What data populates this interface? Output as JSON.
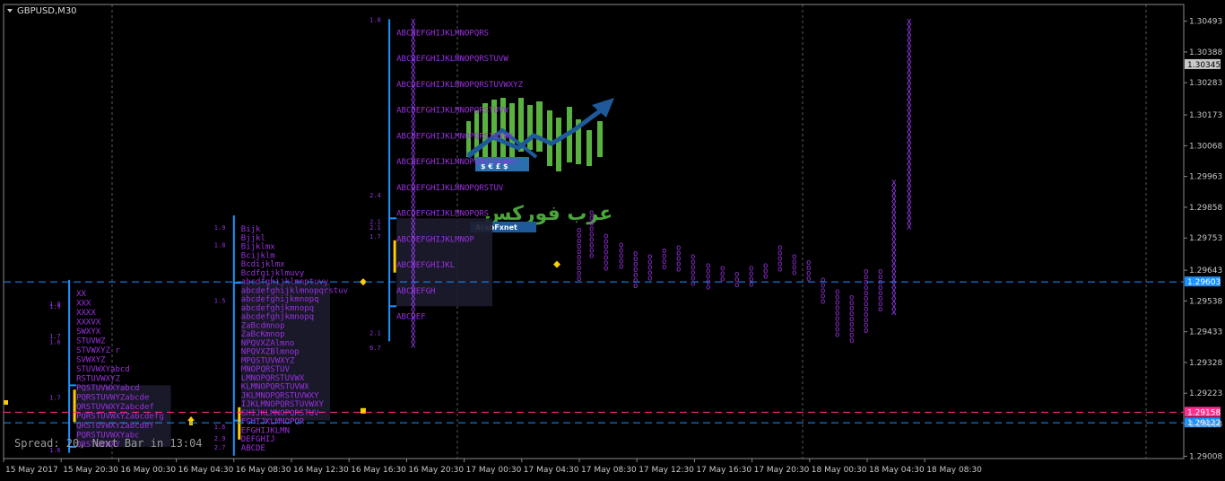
{
  "window": {
    "symbol": "GBPUSD,M30"
  },
  "status": {
    "text": "Spread: 20, Next Bar in 13:04"
  },
  "logo": {
    "arabic": "عرب فوركس",
    "latin": "ArabFxnet"
  },
  "colors": {
    "background": "#000000",
    "grid": "#5a5a5a",
    "axis": "#c8c8c8",
    "blue_line": "#1e90ff",
    "pink_line": "#ff2f8f",
    "tpo": "#9a30e0",
    "profile_bar": "#1e90ff",
    "poc": "#ffd000",
    "value_area": "#1c1c2e"
  },
  "chart_data": {
    "type": "line",
    "title": "",
    "xlabel": "",
    "ylabel": "",
    "ylim": [
      1.29,
      1.3055
    ],
    "y_ticks": [
      "1.30493",
      "1.30388",
      "1.30283",
      "1.30173",
      "1.30068",
      "1.29963",
      "1.29858",
      "1.29753",
      "1.29643",
      "1.29538",
      "1.29433",
      "1.29328",
      "1.29223",
      "1.29118",
      "1.29008"
    ],
    "x_ticks": [
      "15 May 2017",
      "15 May 20:30",
      "16 May 00:30",
      "16 May 04:30",
      "16 May 08:30",
      "16 May 12:30",
      "16 May 16:30",
      "16 May 20:30",
      "17 May 00:30",
      "17 May 04:30",
      "17 May 08:30",
      "17 May 12:30",
      "17 May 16:30",
      "17 May 20:30",
      "18 May 00:30",
      "18 May 04:30",
      "18 May 08:30"
    ],
    "price_lines": [
      {
        "name": "",
        "value": 1.30345,
        "label": "1.30345",
        "color": "#c8c8c8",
        "style": "solid"
      },
      {
        "name": "",
        "value": 1.29603,
        "label": "1.29603",
        "color": "#1e90ff",
        "style": "dashed"
      },
      {
        "name": "",
        "value": 1.29158,
        "label": "1.29158",
        "color": "#ff2f8f",
        "style": "dashed"
      },
      {
        "name": "",
        "value": 1.29122,
        "label": "1.29122",
        "color": "#1e90ff",
        "style": "dashed"
      }
    ],
    "sessions": [
      {
        "x_start": 0.5,
        "x_end": 4.0,
        "high": 1.2961,
        "low": 1.2902,
        "va_high": 1.2925,
        "va_low": 1.2904,
        "poc": 1.2918,
        "labels": [
          {
            "text": "1.9",
            "y": 1.2953
          },
          {
            "text": "1.9",
            "y": 1.2952
          },
          {
            "text": "1.7",
            "y": 1.2942
          },
          {
            "text": "1.6",
            "y": 1.294
          },
          {
            "text": "1.7",
            "y": 1.2921
          },
          {
            "text": "1.6",
            "y": 1.2903
          }
        ],
        "tpo": [
          "XX",
          "XXX",
          "XXXX",
          "XXXVX",
          "SWXYX",
          "STUVWZ",
          "STVWXYZ r",
          "SVWXYZ",
          "STUVWXYabcd",
          "RSTUVWXYZ",
          "PQSTUVWXYabcd",
          "PQRSTUVWYZabcde",
          "QRSTUVWXYZabcdef",
          "PQRSTUVWXYZabcdefg",
          "QRSTUVWXYZabcdef",
          "PQRSTUVWXYabc",
          "QRSTUVWXY"
        ]
      },
      {
        "x_start": 4.0,
        "x_end": 6.7,
        "high": 1.2983,
        "low": 1.2901,
        "va_high": 1.296,
        "va_low": 1.2913,
        "poc": 1.2912,
        "labels": [
          {
            "text": "1.9",
            "y": 1.2979
          },
          {
            "text": "1.8",
            "y": 1.2973
          },
          {
            "text": "1.5",
            "y": 1.2954
          },
          {
            "text": "1.6",
            "y": 1.2911
          },
          {
            "text": "2.9",
            "y": 1.2907
          },
          {
            "text": "2.7",
            "y": 1.2904
          }
        ],
        "tpo": [
          "Bijk",
          "Bjjkl",
          "Bijklmx",
          "Bcijklm",
          "Bcdijklmx",
          "Bcdfgijklmuvy",
          "abcdfghijklmnptuvy",
          "abcdefghijklmnopqrstuv",
          "abcdefghijkmnopq",
          "abcdefghjkmnopq",
          "abcdefghjkmnopq",
          "ZaBcdmnop",
          "ZaBcKmnop",
          "NPQVXZAlmno",
          "NPQVXZBlmnop",
          "MPQSTUVWXYZ",
          "MNOPQRSTUV",
          "LMNOPQRSTUVWX",
          "KLMNOPQRSTUVWX",
          "JKLMNOPQRSTUVWXY",
          "IJKLMNOPQRSTUVWXY",
          "GHIJKLMNOPQRSTUV",
          "FGHIJKLMNOPQR",
          "EFGHIJKLMN",
          "DEFGHIJ",
          "ABCDE"
        ]
      },
      {
        "x_start": 6.7,
        "x_end": 9.6,
        "high": 1.305,
        "low": 1.294,
        "va_high": 1.2982,
        "va_low": 1.2952,
        "poc": 1.2969,
        "labels": [
          {
            "text": "1.8",
            "y": 1.305
          },
          {
            "text": "2.4",
            "y": 1.299
          },
          {
            "text": "2.1",
            "y": 1.2981
          },
          {
            "text": "2.1",
            "y": 1.2979
          },
          {
            "text": "1.7",
            "y": 1.2976
          },
          {
            "text": "2.1",
            "y": 1.2943
          },
          {
            "text": "6.7",
            "y": 1.2938
          }
        ],
        "tpo": [
          "ABCDEFGHIJKLMNOPQRS",
          "ABCDEFGHIJKLMNOPQRSTUVW",
          "ABCDEFGHIJKLMNOPQRSTUVWXYZ",
          "ABCDEFGHIJKLMNOPQRSTUVW",
          "ABCDEFGHIJKLMNOPQRSTUVWX",
          "ABCDEFGHIJKLMNOPQRSTUVWXY",
          "ABCDEFGHIJKLMNOPQRSTUV",
          "ABCDEFGHIJKLMNOPQRS",
          "ABCDEFGHIJKLMNOP",
          "ABCDEFGHIJKL",
          "ABCDEFGH",
          "ABCDEF"
        ]
      }
    ]
  }
}
